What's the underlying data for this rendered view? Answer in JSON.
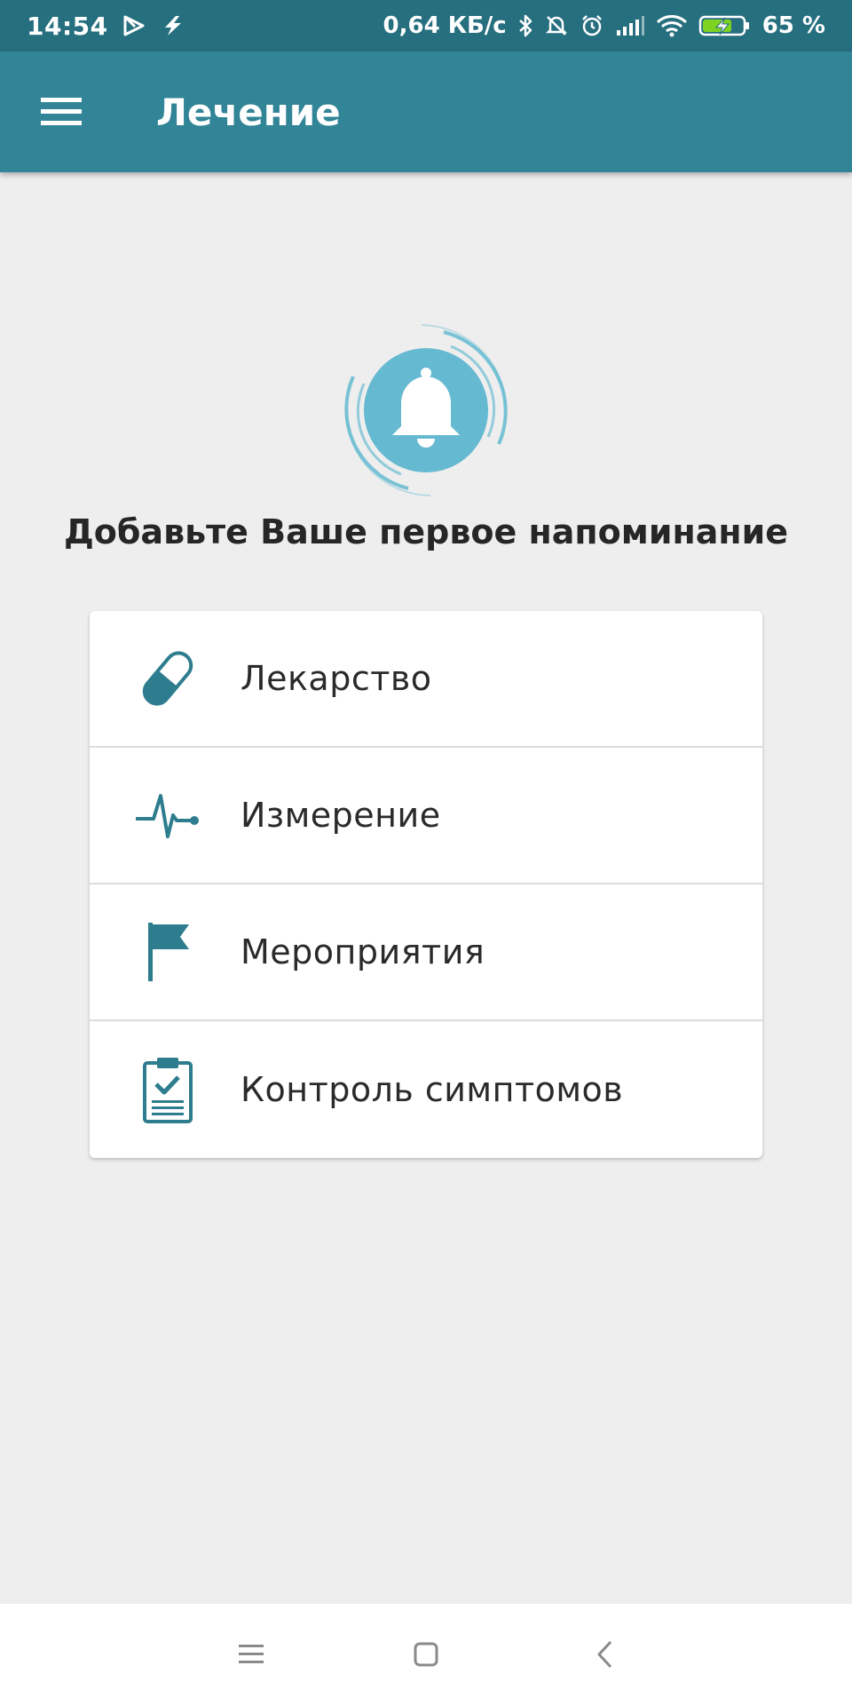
{
  "status_bar": {
    "time": "14:54",
    "network_speed": "0,64 КБ/с",
    "battery_percent": "65 %",
    "icons": [
      "play-store-icon",
      "bolt-app-icon",
      "bluetooth-icon",
      "muted-bell-icon",
      "alarm-icon",
      "signal-icon",
      "wifi-icon",
      "battery-charging-icon"
    ]
  },
  "app_bar": {
    "menu_icon": "hamburger-menu-icon",
    "title": "Лечение"
  },
  "empty_state": {
    "icon": "bell-icon",
    "title": "Добавьте Ваше первое напоминание"
  },
  "options": [
    {
      "label": "Лекарство",
      "icon": "pill-icon"
    },
    {
      "label": "Измерение",
      "icon": "heartbeat-icon"
    },
    {
      "label": "Мероприятия",
      "icon": "flag-icon"
    },
    {
      "label": "Контроль симптомов",
      "icon": "clipboard-check-icon"
    }
  ],
  "nav_bar": {
    "icons": [
      "recent-apps-icon",
      "home-icon",
      "back-icon"
    ]
  },
  "colors": {
    "status_bar": "#266f7f",
    "app_bar": "#328497",
    "accent": "#328497",
    "bell_circle": "#65b9d0",
    "background": "#eeeeee"
  }
}
